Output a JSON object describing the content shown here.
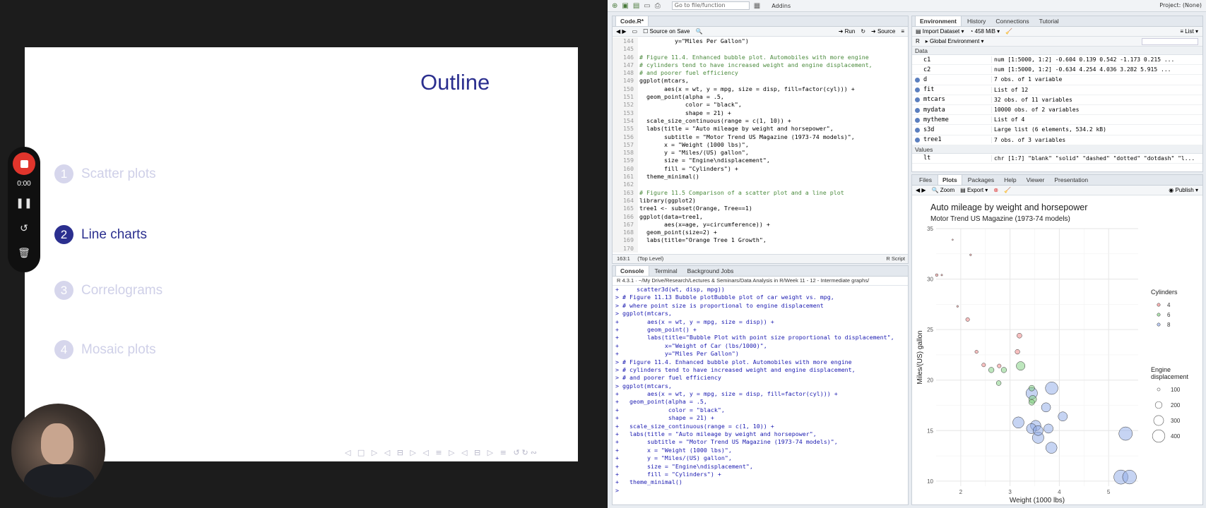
{
  "slide": {
    "title": "Outline",
    "items": [
      {
        "num": "1",
        "label": "Scatter plots",
        "state": "dim"
      },
      {
        "num": "2",
        "label": "Line charts",
        "state": "active"
      },
      {
        "num": "3",
        "label": "Correlograms",
        "state": "dim"
      },
      {
        "num": "4",
        "label": "Mosaic plots",
        "state": "dim"
      }
    ],
    "nav_symbols": "◁ □ ▷ ◁ ⊟ ▷ ◁ ≡ ▷ ◁ ⊟ ▷  ≡  ↺↻∾"
  },
  "recorder": {
    "time": "0:00",
    "pause_icon": "pause-icon",
    "restart_icon": "restart-icon",
    "delete_icon": "trash-icon"
  },
  "rstudio": {
    "toolbar": {
      "goto_placeholder": "Go to file/function",
      "addins": "Addins",
      "project": "Project: (None)"
    },
    "source": {
      "tab": "Code.R*",
      "source_on_save": "Source on Save",
      "run": "Run",
      "source_btn": "Source",
      "status_pos": "163:1",
      "status_level": "(Top Level)",
      "status_type": "R Script",
      "lines": [
        {
          "n": "144",
          "t": "          y=\"Miles Per Gallon\")",
          "c": ""
        },
        {
          "n": "145",
          "t": "",
          "c": ""
        },
        {
          "n": "146",
          "t": "# Figure 11.4. Enhanced bubble plot. Automobiles with more engine",
          "c": "comment"
        },
        {
          "n": "147",
          "t": "# cylinders tend to have increased weight and engine displacement,",
          "c": "comment"
        },
        {
          "n": "148",
          "t": "# and poorer fuel efficiency",
          "c": "comment"
        },
        {
          "n": "149",
          "t": "ggplot(mtcars,",
          "c": ""
        },
        {
          "n": "150",
          "t": "       aes(x = wt, y = mpg, size = disp, fill=factor(cyl))) +",
          "c": ""
        },
        {
          "n": "151",
          "t": "  geom_point(alpha = .5,",
          "c": ""
        },
        {
          "n": "152",
          "t": "             color = \"black\",",
          "c": ""
        },
        {
          "n": "153",
          "t": "             shape = 21) +",
          "c": ""
        },
        {
          "n": "154",
          "t": "  scale_size_continuous(range = c(1, 10)) +",
          "c": ""
        },
        {
          "n": "155",
          "t": "  labs(title = \"Auto mileage by weight and horsepower\",",
          "c": ""
        },
        {
          "n": "156",
          "t": "       subtitle = \"Motor Trend US Magazine (1973-74 models)\",",
          "c": ""
        },
        {
          "n": "157",
          "t": "       x = \"Weight (1000 lbs)\",",
          "c": ""
        },
        {
          "n": "158",
          "t": "       y = \"Miles/(US) gallon\",",
          "c": ""
        },
        {
          "n": "159",
          "t": "       size = \"Engine\\ndisplacement\",",
          "c": ""
        },
        {
          "n": "160",
          "t": "       fill = \"Cylinders\") +",
          "c": ""
        },
        {
          "n": "161",
          "t": "  theme_minimal()",
          "c": ""
        },
        {
          "n": "162",
          "t": "",
          "c": ""
        },
        {
          "n": "163",
          "t": "# Figure 11.5 Comparison of a scatter plot and a line plot",
          "c": "comment"
        },
        {
          "n": "164",
          "t": "library(ggplot2)",
          "c": ""
        },
        {
          "n": "165",
          "t": "tree1 <- subset(Orange, Tree==1)",
          "c": ""
        },
        {
          "n": "166",
          "t": "ggplot(data=tree1,",
          "c": ""
        },
        {
          "n": "167",
          "t": "       aes(x=age, y=circumference)) +",
          "c": ""
        },
        {
          "n": "168",
          "t": "  geom_point(size=2) +",
          "c": ""
        },
        {
          "n": "169",
          "t": "  labs(title=\"Orange Tree 1 Growth\",",
          "c": ""
        },
        {
          "n": "170",
          "t": "",
          "c": ""
        }
      ]
    },
    "console": {
      "tabs": [
        "Console",
        "Terminal",
        "Background Jobs"
      ],
      "path": "R 4.3.1 · ~/My Drive/Research/Lectures & Seminars/Data Analysis in R/Week 11 - 12 - Intermediate graphs/",
      "lines": [
        "+     scatter3d(wt, disp, mpg))",
        "> # Figure 11.13 Bubble plotBubble plot of car weight vs. mpg,",
        "> # where point size is proportional to engine displacement",
        "> ggplot(mtcars,",
        "+        aes(x = wt, y = mpg, size = disp)) +",
        "+        geom_point() +",
        "+        labs(title=\"Bubble Plot with point size proportional to displacement\",",
        "+             x=\"Weight of Car (lbs/1000)\",",
        "+             y=\"Miles Per Gallon\")",
        "> # Figure 11.4. Enhanced bubble plot. Automobiles with more engine",
        "> # cylinders tend to have increased weight and engine displacement,",
        "> # and poorer fuel efficiency",
        "> ggplot(mtcars,",
        "+        aes(x = wt, y = mpg, size = disp, fill=factor(cyl))) +",
        "+   geom_point(alpha = .5,",
        "+              color = \"black\",",
        "+              shape = 21) +",
        "+   scale_size_continuous(range = c(1, 10)) +",
        "+   labs(title = \"Auto mileage by weight and horsepower\",",
        "+        subtitle = \"Motor Trend US Magazine (1973-74 models)\",",
        "+        x = \"Weight (1000 lbs)\",",
        "+        y = \"Miles/(US) gallon\",",
        "+        size = \"Engine\\ndisplacement\",",
        "+        fill = \"Cylinders\") +",
        "+   theme_minimal()",
        ">"
      ]
    },
    "env": {
      "tabs": [
        "Environment",
        "History",
        "Connections",
        "Tutorial"
      ],
      "import": "Import Dataset",
      "memory": "458 MiB",
      "list": "List",
      "lang": "R",
      "scope": "Global Environment",
      "data_hdr": "Data",
      "values_hdr": "Values",
      "rows": [
        {
          "name": "c1",
          "val": "num [1:5000, 1:2] -0.604 0.139 0.542 -1.173 0.215 ...",
          "exp": false
        },
        {
          "name": "c2",
          "val": "num [1:5000, 1:2] -0.634 4.254 4.036 3.282 5.915 ...",
          "exp": false
        },
        {
          "name": "d",
          "val": "7 obs. of 1 variable",
          "exp": true
        },
        {
          "name": "fit",
          "val": "List of  12",
          "exp": true
        },
        {
          "name": "mtcars",
          "val": "32 obs. of 11 variables",
          "exp": true
        },
        {
          "name": "mydata",
          "val": "10000 obs. of 2 variables",
          "exp": true
        },
        {
          "name": "mytheme",
          "val": "List of  4",
          "exp": true
        },
        {
          "name": "s3d",
          "val": "Large list (6 elements,  534.2 kB)",
          "exp": true
        },
        {
          "name": "tree1",
          "val": "7 obs. of 3 variables",
          "exp": true
        }
      ],
      "value_rows": [
        {
          "name": "lt",
          "val": "chr [1:7] \"blank\" \"solid\" \"dashed\" \"dotted\" \"dotdash\" \"l..."
        }
      ]
    },
    "plots": {
      "tabs": [
        "Files",
        "Plots",
        "Packages",
        "Help",
        "Viewer",
        "Presentation"
      ],
      "zoom": "Zoom",
      "export": "Export",
      "publish": "Publish"
    }
  },
  "chart_data": {
    "type": "scatter",
    "title": "Auto mileage by weight and horsepower",
    "subtitle": "Motor Trend US Magazine (1973-74 models)",
    "xlabel": "Weight (1000 lbs)",
    "ylabel": "Miles/(US) gallon",
    "xlim": [
      1.5,
      5.6
    ],
    "ylim": [
      9.5,
      35
    ],
    "xticks": [
      2,
      3,
      4,
      5
    ],
    "yticks": [
      10,
      15,
      20,
      25,
      30,
      35
    ],
    "grid": true,
    "legend_fill_title": "Cylinders",
    "legend_size_title": "Engine\ndisplacement",
    "size_breaks": [
      100,
      200,
      300,
      400
    ],
    "colors": {
      "4": "#f08080",
      "6": "#7ccd7c",
      "8": "#8ea9e8"
    },
    "points": [
      {
        "x": 2.62,
        "y": 21.0,
        "cyl": "6",
        "disp": 160
      },
      {
        "x": 2.875,
        "y": 21.0,
        "cyl": "6",
        "disp": 160
      },
      {
        "x": 2.32,
        "y": 22.8,
        "cyl": "4",
        "disp": 108
      },
      {
        "x": 3.215,
        "y": 21.4,
        "cyl": "6",
        "disp": 258
      },
      {
        "x": 3.44,
        "y": 18.7,
        "cyl": "8",
        "disp": 360
      },
      {
        "x": 3.46,
        "y": 18.1,
        "cyl": "6",
        "disp": 225
      },
      {
        "x": 3.57,
        "y": 14.3,
        "cyl": "8",
        "disp": 360
      },
      {
        "x": 3.19,
        "y": 24.4,
        "cyl": "4",
        "disp": 147
      },
      {
        "x": 3.15,
        "y": 22.8,
        "cyl": "4",
        "disp": 141
      },
      {
        "x": 3.44,
        "y": 19.2,
        "cyl": "6",
        "disp": 168
      },
      {
        "x": 3.44,
        "y": 17.8,
        "cyl": "6",
        "disp": 168
      },
      {
        "x": 4.07,
        "y": 16.4,
        "cyl": "8",
        "disp": 276
      },
      {
        "x": 3.73,
        "y": 17.3,
        "cyl": "8",
        "disp": 276
      },
      {
        "x": 3.78,
        "y": 15.2,
        "cyl": "8",
        "disp": 276
      },
      {
        "x": 5.25,
        "y": 10.4,
        "cyl": "8",
        "disp": 472
      },
      {
        "x": 5.424,
        "y": 10.4,
        "cyl": "8",
        "disp": 460
      },
      {
        "x": 5.345,
        "y": 14.7,
        "cyl": "8",
        "disp": 440
      },
      {
        "x": 2.2,
        "y": 32.4,
        "cyl": "4",
        "disp": 79
      },
      {
        "x": 1.615,
        "y": 30.4,
        "cyl": "4",
        "disp": 76
      },
      {
        "x": 1.835,
        "y": 33.9,
        "cyl": "4",
        "disp": 71
      },
      {
        "x": 2.465,
        "y": 21.5,
        "cyl": "4",
        "disp": 120
      },
      {
        "x": 3.52,
        "y": 15.5,
        "cyl": "8",
        "disp": 318
      },
      {
        "x": 3.435,
        "y": 15.2,
        "cyl": "8",
        "disp": 304
      },
      {
        "x": 3.84,
        "y": 13.3,
        "cyl": "8",
        "disp": 350
      },
      {
        "x": 3.845,
        "y": 19.2,
        "cyl": "8",
        "disp": 400
      },
      {
        "x": 1.935,
        "y": 27.3,
        "cyl": "4",
        "disp": 79
      },
      {
        "x": 2.14,
        "y": 26.0,
        "cyl": "4",
        "disp": 120
      },
      {
        "x": 1.513,
        "y": 30.4,
        "cyl": "4",
        "disp": 95
      },
      {
        "x": 3.17,
        "y": 15.8,
        "cyl": "8",
        "disp": 351
      },
      {
        "x": 2.77,
        "y": 19.7,
        "cyl": "6",
        "disp": 145
      },
      {
        "x": 3.57,
        "y": 15.0,
        "cyl": "8",
        "disp": 301
      },
      {
        "x": 2.78,
        "y": 21.4,
        "cyl": "4",
        "disp": 121
      }
    ]
  }
}
